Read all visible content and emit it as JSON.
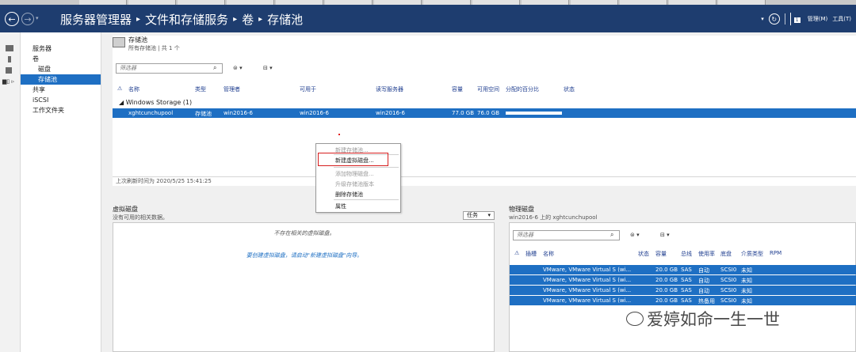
{
  "taskbar": {
    "items": [
      "",
      "",
      "",
      "",
      "",
      "",
      "",
      "",
      "",
      "",
      "",
      "",
      "",
      ""
    ]
  },
  "titlebar": {
    "breadcrumb": [
      "服务器管理器",
      "文件和存储服务",
      "卷",
      "存储池"
    ],
    "separator": "▸",
    "manage_label": "管理(M)",
    "tools_label": "工具(T)",
    "flag_count": "1"
  },
  "nav": {
    "items": [
      {
        "label": "服务器"
      },
      {
        "label": "卷"
      },
      {
        "label": "磁盘"
      },
      {
        "label": "存储池"
      },
      {
        "label": "共享"
      },
      {
        "label": "iSCSI"
      },
      {
        "label": "工作文件夹"
      }
    ]
  },
  "pool_panel": {
    "title": "存储池",
    "subtitle": "所有存储池 | 共 1 个",
    "filter_placeholder": "筛选器",
    "columns": [
      "名称",
      "类型",
      "管理者",
      "可用于",
      "读写服务器",
      "容量",
      "可用空间",
      "分配的百分比",
      "状态"
    ],
    "group_label": "Windows Storage (1)",
    "row": {
      "name": "xghtcunchupool",
      "type": "存储池",
      "managed_by": "win2016-6",
      "available_to": "win2016-6",
      "rw_server": "win2016-6",
      "capacity": "77.0 GB",
      "free_space": "76.0 GB",
      "allocated_fraction": 0.99
    },
    "last_refresh": "上次刷新时间为 2020/5/25 15:41:25"
  },
  "context_menu": {
    "items": [
      {
        "label": "新建存储池...",
        "disabled": true
      },
      {
        "label": "新建虚拟磁盘...",
        "disabled": false,
        "highlighted": true
      },
      {
        "label": "添加物理磁盘...",
        "disabled": true
      },
      {
        "label": "升级存储池版本",
        "disabled": true
      },
      {
        "label": "删除存储池",
        "disabled": false
      },
      {
        "label": "属性",
        "disabled": false
      }
    ],
    "highlight_color": "#d61f1f"
  },
  "virtual_disks": {
    "title": "虚拟磁盘",
    "subtitle": "没有可用的相关数据。",
    "tasks_label": "任务",
    "empty_msg": "不存在相关的虚拟磁盘。",
    "hint_msg": "要创建虚拟磁盘，请启动\"新建虚拟磁盘\"向导。"
  },
  "physical_disks": {
    "title": "物理磁盘",
    "subtitle": "win2016-6 上的 xghtcunchupool",
    "filter_placeholder": "筛选器",
    "columns": [
      "插槽",
      "名称",
      "状态",
      "容量",
      "总线",
      "使用率",
      "底盘",
      "介质类型",
      "RPM"
    ],
    "rows": [
      {
        "name": "VMware, VMware Virtual S (wi...",
        "capacity": "20.0 GB",
        "bus": "SAS",
        "usage": "自动",
        "chassis": "SCSI0",
        "media": "未知"
      },
      {
        "name": "VMware, VMware Virtual S (wi...",
        "capacity": "20.0 GB",
        "bus": "SAS",
        "usage": "自动",
        "chassis": "SCSI0",
        "media": "未知"
      },
      {
        "name": "VMware, VMware Virtual S (wi...",
        "capacity": "20.0 GB",
        "bus": "SAS",
        "usage": "自动",
        "chassis": "SCSI0",
        "media": "未知"
      },
      {
        "name": "VMware, VMware Virtual S (wi...",
        "capacity": "20.0 GB",
        "bus": "SAS",
        "usage": "热备用",
        "chassis": "SCSI0",
        "media": "未知"
      }
    ]
  },
  "watermark": {
    "text": "爱婷如命一生一世"
  },
  "colors": {
    "titlebar": "#1e3d6f",
    "selection": "#1e6fc3"
  }
}
